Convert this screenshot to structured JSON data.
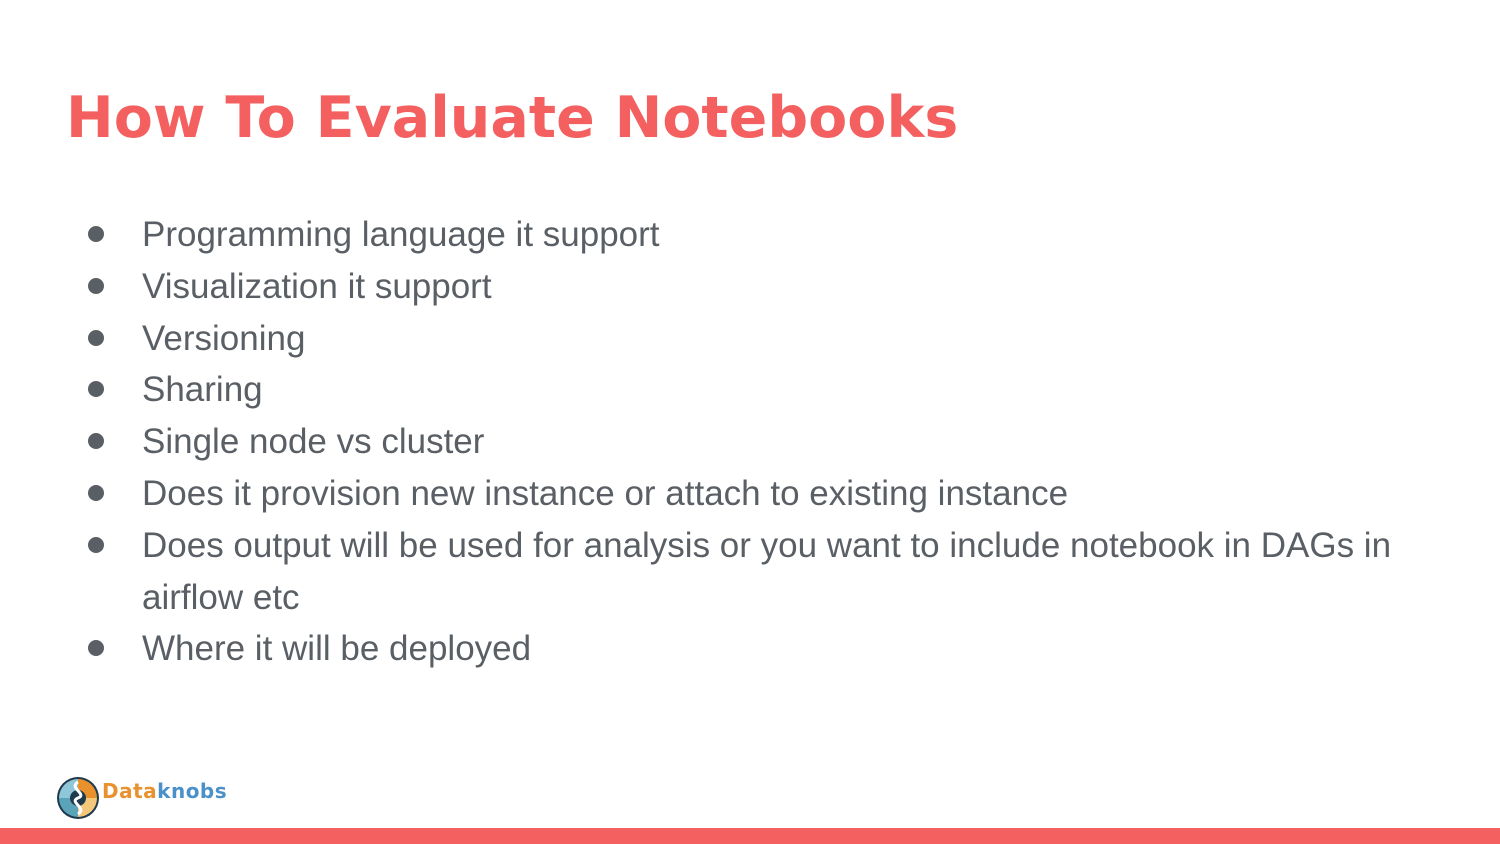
{
  "slide": {
    "title": "How To Evaluate Notebooks",
    "bullets": [
      "Programming language it support",
      "Visualization it support",
      "Versioning",
      "Sharing",
      "Single node vs cluster",
      "Does it provision new instance or attach to existing instance",
      "Does output will be used for analysis or you want to include notebook in DAGs in airflow etc",
      "Where it will be deployed"
    ]
  },
  "logo": {
    "text_part1": "Data",
    "text_part2": "knobs",
    "icon": "dataknobs-logo-icon"
  },
  "colors": {
    "accent": "#f46060",
    "body_text": "#595f64",
    "logo_orange": "#e8912d",
    "logo_blue": "#4a90c9"
  }
}
